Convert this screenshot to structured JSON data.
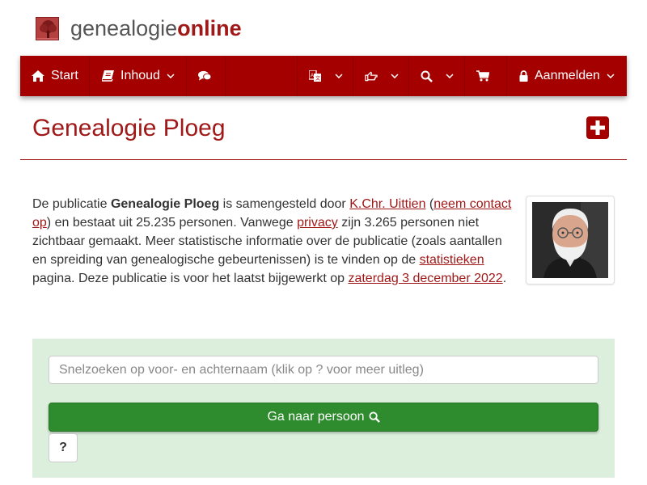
{
  "brand": {
    "name_part1": "genealogie",
    "name_part2": "online",
    "logo_icon": "tree-icon",
    "color_primary": "#a50000",
    "color_text": "#a01818"
  },
  "nav": {
    "start": "Start",
    "contents": "Inhoud",
    "login": "Aanmelden",
    "icons": [
      "home-icon",
      "book-icon",
      "comments-icon",
      "translate-icon",
      "hand-pointer-icon",
      "search-icon",
      "cart-icon",
      "lock-icon"
    ]
  },
  "page": {
    "title": "Genealogie Ploeg"
  },
  "intro": {
    "t1": "De publicatie ",
    "pub_name": "Genealogie Ploeg",
    "t2": " is samengesteld door ",
    "author_link": "K.Chr. Uittien",
    "t3": " (",
    "contact_link": "neem contact op",
    "t4": ") en bestaat uit 25.235 personen. Vanwege ",
    "privacy_link": "privacy",
    "t5": " zijn 3.265 personen niet zichtbaar gemaakt. Meer statistische informatie over de publicatie (zoals aantallen en spreiding van genealogische gebeurtenissen) is te vinden op de ",
    "stats_link": "statistieken",
    "t6": " pagina. Deze publicatie is voor het laatst bijgewerkt op ",
    "date_link": "zaterdag 3 december 2022",
    "t7": "."
  },
  "search": {
    "placeholder": "Snelzoeken op voor- en achternaam (klik op ? voor meer uitleg)",
    "button_label": "Ga naar persoon",
    "help_label": "?",
    "panel_color": "#dcefdc",
    "button_color": "#2e8b2e"
  }
}
